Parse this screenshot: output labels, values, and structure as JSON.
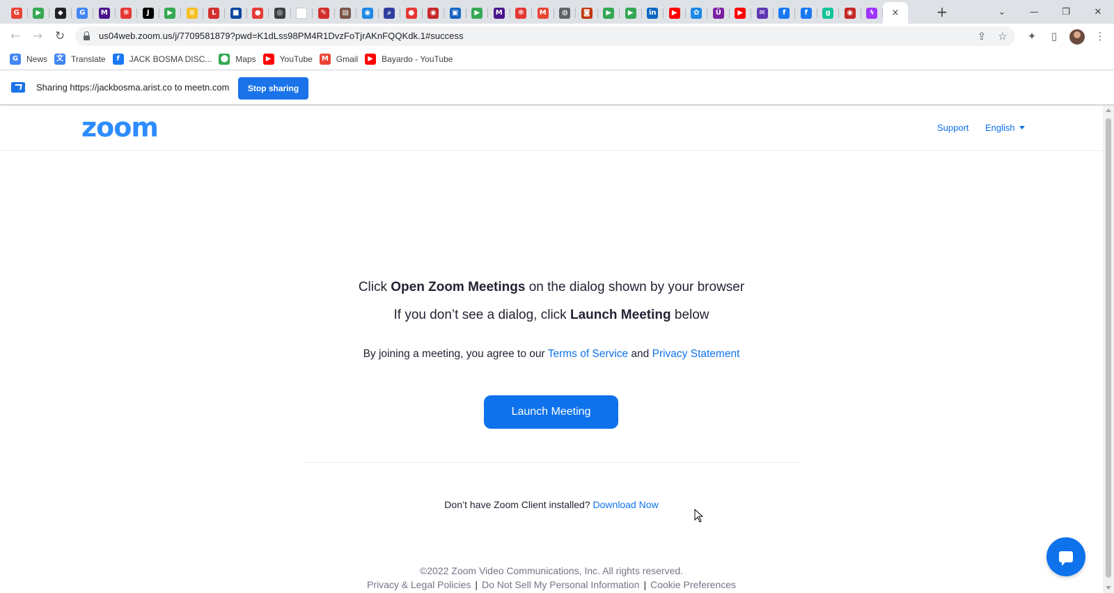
{
  "browser": {
    "tabs": [
      {
        "icon": "google-icon",
        "glyph": "G",
        "color": "#ea4335"
      },
      {
        "icon": "play-icon",
        "glyph": "▶",
        "color": "#34a853"
      },
      {
        "icon": "diamond-icon",
        "glyph": "◆",
        "color": "#202124"
      },
      {
        "icon": "google-icon",
        "glyph": "G",
        "color": "#4285f4"
      },
      {
        "icon": "chart-icon",
        "glyph": "M",
        "color": "#4a148c"
      },
      {
        "icon": "asterisk-icon",
        "glyph": "✻",
        "color": "#e53935"
      },
      {
        "icon": "book-icon",
        "glyph": "J",
        "color": "#000000"
      },
      {
        "icon": "play-icon",
        "glyph": "▶",
        "color": "#34a853"
      },
      {
        "icon": "doc-icon",
        "glyph": "≡",
        "color": "#f6bf26"
      },
      {
        "icon": "record-icon",
        "glyph": "L",
        "color": "#d32f2f"
      },
      {
        "icon": "square-icon",
        "glyph": "■",
        "color": "#0d47a1"
      },
      {
        "icon": "record-icon",
        "glyph": "●",
        "color": "#e53935"
      },
      {
        "icon": "chrome-icon",
        "glyph": "◎",
        "color": "#3c4043"
      },
      {
        "icon": "blank-icon",
        "glyph": "",
        "color": "#ffffff"
      },
      {
        "icon": "pen-icon",
        "glyph": "✎",
        "color": "#d32f2f"
      },
      {
        "icon": "image-icon",
        "glyph": "▤",
        "color": "#795548"
      },
      {
        "icon": "globe-icon",
        "glyph": "◉",
        "color": "#1e88e5"
      },
      {
        "icon": "search-icon",
        "glyph": "⌕",
        "color": "#303f9f"
      },
      {
        "icon": "record-icon",
        "glyph": "●",
        "color": "#e53935"
      },
      {
        "icon": "record-icon",
        "glyph": "◉",
        "color": "#c62828"
      },
      {
        "icon": "monitor-icon",
        "glyph": "▣",
        "color": "#1565c0"
      },
      {
        "icon": "play-icon",
        "glyph": "▶",
        "color": "#34a853"
      },
      {
        "icon": "chart-icon",
        "glyph": "M",
        "color": "#4a148c"
      },
      {
        "icon": "asterisk-icon",
        "glyph": "✻",
        "color": "#e53935"
      },
      {
        "icon": "gmail-icon",
        "glyph": "M",
        "color": "#ea4335"
      },
      {
        "icon": "globe-icon",
        "glyph": "◍",
        "color": "#5f6368"
      },
      {
        "icon": "mask-icon",
        "glyph": "◙",
        "color": "#bf360c"
      },
      {
        "icon": "play-icon",
        "glyph": "▶",
        "color": "#34a853"
      },
      {
        "icon": "play-icon",
        "glyph": "▶",
        "color": "#34a853"
      },
      {
        "icon": "linkedin-icon",
        "glyph": "in",
        "color": "#0a66c2"
      },
      {
        "icon": "youtube-icon",
        "glyph": "▶",
        "color": "#ff0000"
      },
      {
        "icon": "brain-icon",
        "glyph": "✿",
        "color": "#1e88e5"
      },
      {
        "icon": "u-icon",
        "glyph": "Ü",
        "color": "#7b1fa2"
      },
      {
        "icon": "youtube-icon",
        "glyph": "▶",
        "color": "#ff0000"
      },
      {
        "icon": "mail-icon",
        "glyph": "✉",
        "color": "#5e35b1"
      },
      {
        "icon": "facebook-icon",
        "glyph": "f",
        "color": "#1877f2"
      },
      {
        "icon": "facebook-icon",
        "glyph": "f",
        "color": "#1877f2"
      },
      {
        "icon": "grammarly-icon",
        "glyph": "g",
        "color": "#15c39a"
      },
      {
        "icon": "record-icon",
        "glyph": "◉",
        "color": "#c62828"
      },
      {
        "icon": "messenger-icon",
        "glyph": "ϟ",
        "color": "#a033ff"
      }
    ],
    "active_tab_close": "×",
    "new_tab": "+",
    "url": "us04web.zoom.us/j/7709581879?pwd=K1dLss98PM4R1DvzFoTjrAKnFQQKdk.1#success",
    "bookmarks": [
      {
        "label": "News",
        "icon": "news-icon",
        "glyph": "G",
        "color": "#4285f4"
      },
      {
        "label": "Translate",
        "icon": "translate-icon",
        "glyph": "文",
        "color": "#4285f4"
      },
      {
        "label": "JACK BOSMA DISC...",
        "icon": "facebook-icon",
        "glyph": "f",
        "color": "#1877f2"
      },
      {
        "label": "Maps",
        "icon": "maps-icon",
        "glyph": "⬤",
        "color": "#34a853"
      },
      {
        "label": "YouTube",
        "icon": "youtube-icon",
        "glyph": "▶",
        "color": "#ff0000"
      },
      {
        "label": "Gmail",
        "icon": "gmail-icon",
        "glyph": "M",
        "color": "#ea4335"
      },
      {
        "label": "Bayardo - YouTube",
        "icon": "youtube-icon",
        "glyph": "▶",
        "color": "#ff0000"
      }
    ]
  },
  "sharing": {
    "text": "Sharing https://jackbosma.arist.co to meetn.com",
    "stop_label": "Stop sharing"
  },
  "zoom": {
    "logo": "zoom",
    "support": "Support",
    "language": "English",
    "line1_pre": "Click ",
    "line1_bold": "Open Zoom Meetings",
    "line1_post": " on the dialog shown by your browser",
    "line2_pre": "If you don’t see a dialog, click ",
    "line2_bold": "Launch Meeting",
    "line2_post": " below",
    "terms_pre": "By joining a meeting, you agree to our ",
    "terms_link": "Terms of Service",
    "terms_mid": " and ",
    "privacy_link": "Privacy Statement",
    "launch_label": "Launch Meeting",
    "download_pre": "Don’t have Zoom Client installed? ",
    "download_link": "Download Now",
    "copyright": "©2022 Zoom Video Communications, Inc. All rights reserved.",
    "legal_1": "Privacy & Legal Policies",
    "legal_2": "Do Not Sell My Personal Information",
    "legal_3": "Cookie Preferences",
    "separator": "|"
  },
  "colors": {
    "zoom_blue": "#0e72ed",
    "chrome_blue": "#1a73e8"
  }
}
